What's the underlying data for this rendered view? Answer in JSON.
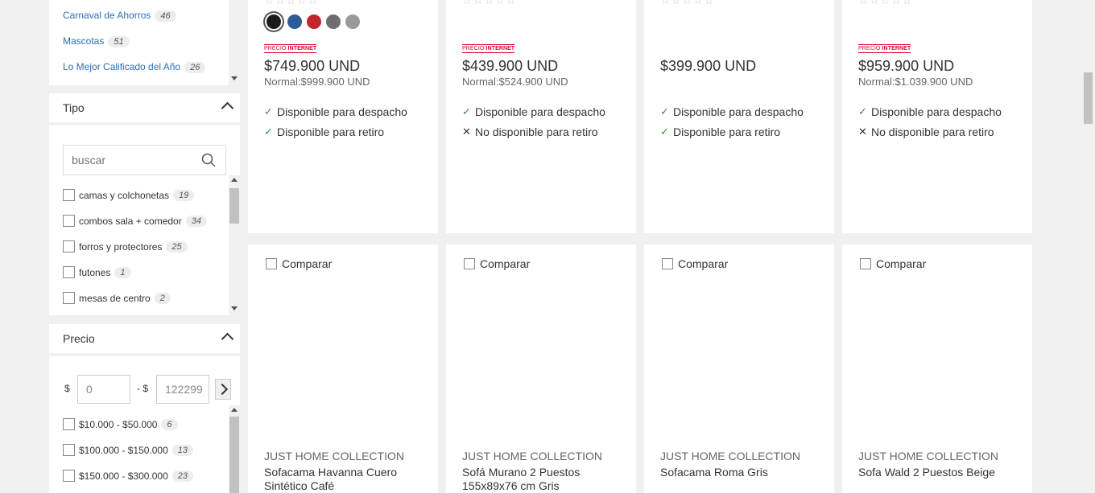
{
  "promo_list": {
    "items": [
      {
        "label": "Carnaval de Ahorros",
        "count": "46"
      },
      {
        "label": "Mascotas",
        "count": "51"
      },
      {
        "label": "Lo Mejor Calificado del Año",
        "count": "26"
      }
    ]
  },
  "tipo": {
    "title": "Tipo",
    "search_placeholder": "buscar",
    "options": [
      {
        "label": "camas y colchonetas",
        "count": "19"
      },
      {
        "label": "combos sala + comedor",
        "count": "34"
      },
      {
        "label": "forros y protectores",
        "count": "25"
      },
      {
        "label": "futones",
        "count": "1"
      },
      {
        "label": "mesas de centro",
        "count": "2"
      }
    ]
  },
  "precio": {
    "title": "Precio",
    "currency": "$",
    "separator": "- $",
    "min_value": "0",
    "max_value": "122299",
    "ranges": [
      {
        "label": "$10.000 - $50.000",
        "count": "6"
      },
      {
        "label": "$100.000 - $150.000",
        "count": "13"
      },
      {
        "label": "$150.000 - $300.000",
        "count": "23"
      }
    ]
  },
  "badge": {
    "prefix": "PRECIO",
    "suffix": "INTERNET"
  },
  "top_cards": [
    {
      "price": "$749.900 UND",
      "normal": "Normal:$999.900 UND",
      "despacho": "Disponible para despacho",
      "retiro": "Disponible para retiro",
      "despacho_mark": "✓",
      "retiro_mark": "✓"
    },
    {
      "price": "$439.900 UND",
      "normal": "Normal:$524.900 UND",
      "despacho": "Disponible para despacho",
      "retiro": "No disponible para retiro",
      "despacho_mark": "✓",
      "retiro_mark": "✕"
    },
    {
      "price": "$399.900 UND",
      "normal": "",
      "despacho": "Disponible para despacho",
      "retiro": "Disponible para retiro",
      "despacho_mark": "✓",
      "retiro_mark": "✓"
    },
    {
      "price": "$959.900 UND",
      "normal": "Normal:$1.039.900 UND",
      "despacho": "Disponible para despacho",
      "retiro": "No disponible para retiro",
      "despacho_mark": "✓",
      "retiro_mark": "✕"
    }
  ],
  "swatch_colors": [
    "#1b1b1b",
    "#2e5a98",
    "#c4242b",
    "#6e6e70",
    "#9a999c"
  ],
  "compare_label": "Comparar",
  "bottom_cards": [
    {
      "brand": "JUST HOME COLLECTION",
      "name": "Sofacama Havanna Cuero Sintético Café"
    },
    {
      "brand": "JUST HOME COLLECTION",
      "name": "Sofá Murano 2 Puestos 155x89x76 cm Gris"
    },
    {
      "brand": "JUST HOME COLLECTION",
      "name": "Sofacama Roma Gris"
    },
    {
      "brand": "JUST HOME COLLECTION",
      "name": "Sofa Wald 2 Puestos Beige"
    }
  ]
}
